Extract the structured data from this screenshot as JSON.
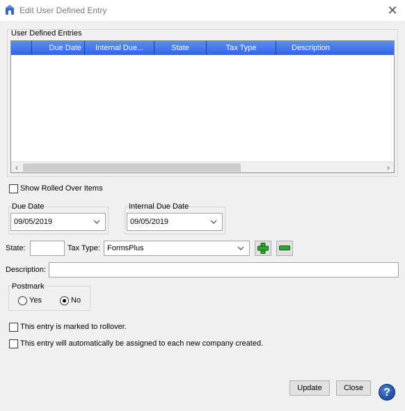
{
  "window": {
    "title": "Edit User Defined Entry"
  },
  "entries_group": {
    "title": "User Defined Entries",
    "columns": [
      "",
      "Due Date",
      "Internal Due...",
      "State",
      "Tax Type",
      "Description"
    ],
    "rows": []
  },
  "show_rolled_over": {
    "label": "Show Rolled Over Items",
    "checked": false
  },
  "due_date": {
    "label": "Due Date",
    "value": "09/05/2019"
  },
  "internal_due_date": {
    "label": "Internal Due Date",
    "value": "09/05/2019"
  },
  "state": {
    "label": "State:",
    "value": ""
  },
  "tax_type": {
    "label": "Tax Type:",
    "value": "FormsPlus"
  },
  "description": {
    "label": "Description:",
    "value": ""
  },
  "postmark": {
    "title": "Postmark",
    "yes_label": "Yes",
    "no_label": "No",
    "selected": "No"
  },
  "rollover_check": {
    "label": "This entry is marked to rollover.",
    "checked": false
  },
  "auto_assign_check": {
    "label": "This entry will automatically be assigned to each new company created.",
    "checked": false
  },
  "buttons": {
    "update": "Update",
    "close": "Close",
    "help": "?"
  },
  "colors": {
    "header": "#2f64e8",
    "help": "#103c8f",
    "add": "#2ea82e",
    "remove": "#2ea82e"
  },
  "icons": {
    "add": "plus-icon",
    "remove": "minus-icon",
    "close": "close-icon",
    "help": "help-icon",
    "dropdown": "chevron-down-icon"
  }
}
